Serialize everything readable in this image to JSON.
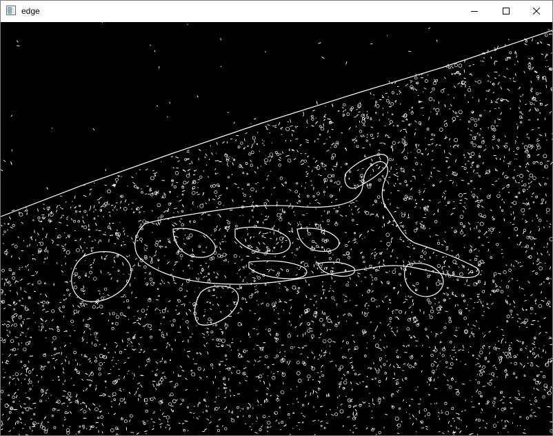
{
  "window": {
    "title": "edge",
    "controls": {
      "minimize": "minimize",
      "maximize": "maximize",
      "close": "close"
    }
  },
  "image": {
    "description_icon": "image-icon",
    "background_color": "#000000",
    "edge_color": "#ffffff"
  }
}
